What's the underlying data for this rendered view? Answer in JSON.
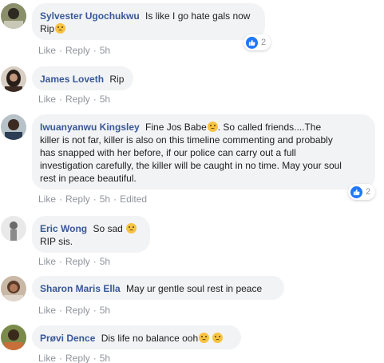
{
  "comments": [
    {
      "name": "Sylvester Ugochukwu",
      "text": "Is like I go hate gals now",
      "text2": "Rip",
      "like": "Like",
      "reply": "Reply",
      "time": "5h",
      "reaction_count": "2"
    },
    {
      "name": "James Loveth",
      "text": "Rip",
      "like": "Like",
      "reply": "Reply",
      "time": "5h"
    },
    {
      "name": "Iwuanyanwu Kingsley",
      "text_a": "Fine Jos Babe",
      "text_b": ". So called friends....The",
      "line2": "killer is not far, killer is also on this timeline commenting and probably",
      "line3": "has snapped with her before, if our police can carry out a full",
      "line4": "investigation carefully, the killer will be caught in no time. May your soul",
      "line5": "rest in peace beautiful.",
      "like": "Like",
      "reply": "Reply",
      "time": "5h",
      "edited": "Edited",
      "reaction_count": "2"
    },
    {
      "name": "Eric Wong",
      "text": "So sad",
      "text2": "RIP sis.",
      "like": "Like",
      "reply": "Reply",
      "time": "5h"
    },
    {
      "name": "Sharon Maris Ella",
      "text": "May ur gentle soul rest in peace",
      "like": "Like",
      "reply": "Reply",
      "time": "5h"
    },
    {
      "name": "Prøvi Dence",
      "text": "Dis life no balance ooh",
      "like": "Like",
      "reply": "Reply",
      "time": "5h"
    }
  ],
  "colors": {
    "name": "#385898",
    "bubble": "#f2f3f5",
    "meta": "#90949c",
    "like_blue": "#2078f4"
  },
  "icons": {
    "reaction": "like-thumb-icon",
    "emoji_sad": "sad-face-emoji",
    "emoji_grimace": "tired-face-emoji"
  }
}
